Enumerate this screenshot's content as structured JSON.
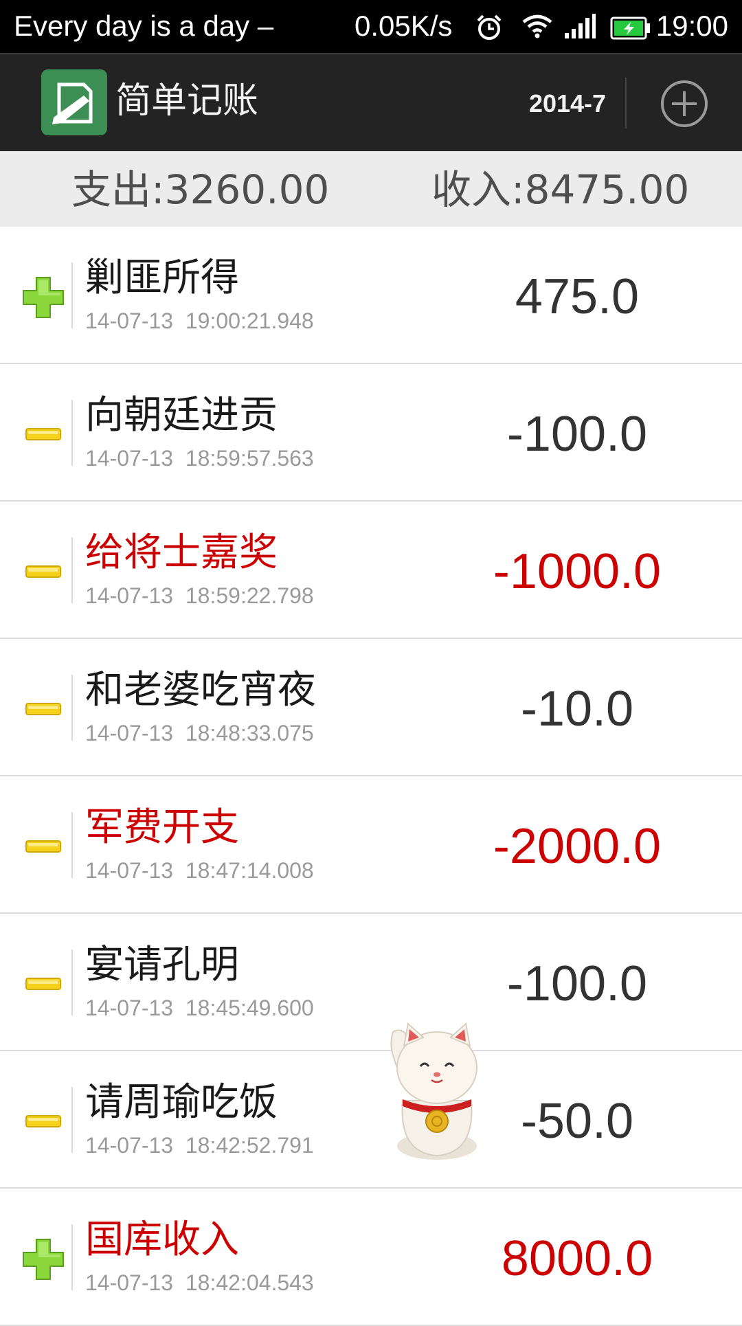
{
  "status_bar": {
    "marquee": "Every day is a day –",
    "net_speed": "0.05K/s",
    "time": "19:00",
    "icons": [
      "alarm-clock-icon",
      "wifi-icon",
      "signal-icon",
      "battery-charging-icon"
    ]
  },
  "action_bar": {
    "title": "简单记账",
    "month": "2014-7",
    "app_icon": "ledger-pen-icon",
    "add_icon": "add-circle-icon"
  },
  "summary": {
    "expense_label": "支出:3260.00",
    "income_label": "收入:8475.00"
  },
  "colors": {
    "highlight": "#cc0000",
    "normal": "#1a1a1a",
    "amount_normal": "#333333",
    "income_icon": "#8bd63a",
    "expense_icon": "#f5d21a"
  },
  "records": [
    {
      "type": "income",
      "title": "剿匪所得",
      "time": "14-07-13  19:00:21.948",
      "amount": "475.0",
      "highlight": false
    },
    {
      "type": "expense",
      "title": "向朝廷进贡",
      "time": "14-07-13  18:59:57.563",
      "amount": "-100.0",
      "highlight": false
    },
    {
      "type": "expense",
      "title": "给将士嘉奖",
      "time": "14-07-13  18:59:22.798",
      "amount": "-1000.0",
      "highlight": true
    },
    {
      "type": "expense",
      "title": "和老婆吃宵夜",
      "time": "14-07-13  18:48:33.075",
      "amount": "-10.0",
      "highlight": false
    },
    {
      "type": "expense",
      "title": "军费开支",
      "time": "14-07-13  18:47:14.008",
      "amount": "-2000.0",
      "highlight": true
    },
    {
      "type": "expense",
      "title": "宴请孔明",
      "time": "14-07-13  18:45:49.600",
      "amount": "-100.0",
      "highlight": false
    },
    {
      "type": "expense",
      "title": "请周瑜吃饭",
      "time": "14-07-13  18:42:52.791",
      "amount": "-50.0",
      "highlight": false
    },
    {
      "type": "income",
      "title": "国库收入",
      "time": "14-07-13  18:42:04.543",
      "amount": "8000.0",
      "highlight": true
    }
  ]
}
